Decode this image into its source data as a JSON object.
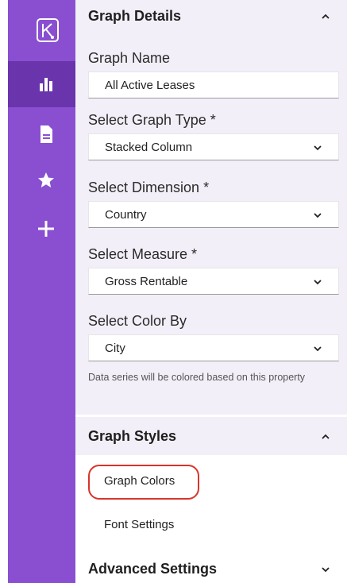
{
  "sidebar": {
    "items": [
      {
        "name": "bar-chart-icon",
        "active": true
      },
      {
        "name": "document-icon",
        "active": false
      },
      {
        "name": "star-icon",
        "active": false
      },
      {
        "name": "plus-icon",
        "active": false
      }
    ]
  },
  "graph_details": {
    "title": "Graph Details",
    "graph_name_label": "Graph Name",
    "graph_name_value": "All Active Leases",
    "graph_type_label": "Select Graph Type *",
    "graph_type_value": "Stacked Column",
    "dimension_label": "Select Dimension  *",
    "dimension_value": "Country",
    "measure_label": "Select Measure  *",
    "measure_value": "Gross Rentable",
    "color_by_label": "Select Color By",
    "color_by_value": "City",
    "color_by_help": "Data series will be colored based on this property"
  },
  "graph_styles": {
    "title": "Graph Styles",
    "items": [
      "Graph Colors",
      "Font Settings"
    ]
  },
  "advanced_settings": {
    "title": "Advanced Settings"
  },
  "colors": {
    "sidebar": "#8a4fd0",
    "sidebar_active": "#6a34ad",
    "section_header": "#f3eff8",
    "highlight": "#d9342b"
  }
}
